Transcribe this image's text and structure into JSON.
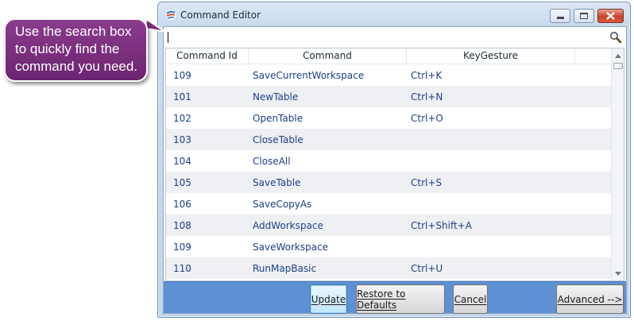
{
  "window": {
    "title": "Command Editor",
    "controls": {
      "minimize": "minimize",
      "maximize": "maximize",
      "close": "close"
    }
  },
  "search": {
    "value": "",
    "icon": "search-icon"
  },
  "table": {
    "columns": [
      "Command Id",
      "Command",
      "KeyGesture",
      ""
    ],
    "rows": [
      {
        "id": "109",
        "command": "SaveCurrentWorkspace",
        "key": "Ctrl+K"
      },
      {
        "id": "101",
        "command": "NewTable",
        "key": "Ctrl+N"
      },
      {
        "id": "102",
        "command": "OpenTable",
        "key": "Ctrl+O"
      },
      {
        "id": "103",
        "command": "CloseTable",
        "key": ""
      },
      {
        "id": "104",
        "command": "CloseAll",
        "key": ""
      },
      {
        "id": "105",
        "command": "SaveTable",
        "key": "Ctrl+S"
      },
      {
        "id": "106",
        "command": "SaveCopyAs",
        "key": ""
      },
      {
        "id": "108",
        "command": "AddWorkspace",
        "key": "Ctrl+Shift+A"
      },
      {
        "id": "109",
        "command": "SaveWorkspace",
        "key": ""
      },
      {
        "id": "110",
        "command": "RunMapBasic",
        "key": "Ctrl+U"
      }
    ]
  },
  "buttons": {
    "update": "Update",
    "restore": "Restore to Defaults",
    "cancel": "Cancel",
    "advanced": "Advanced -->"
  },
  "callout": {
    "lines": [
      "Use the search box",
      "to quickly find the",
      "command you need."
    ]
  },
  "colors": {
    "accent_strip": "#5e91d4",
    "callout_fill": "#7a2e7d",
    "row_text": "#1d3e8a",
    "close_button": "#c8442c"
  }
}
